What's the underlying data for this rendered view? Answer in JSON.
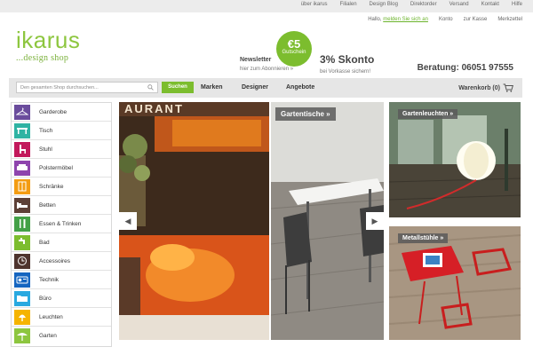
{
  "topbar": {
    "links": [
      "über ikarus",
      "Filialen",
      "Design Blog",
      "Direktorder",
      "Versand",
      "Kontakt",
      "Hilfe"
    ]
  },
  "userbar": {
    "greeting": "Hallo,",
    "login": "melden Sie sich an",
    "account": "Konto",
    "checkout": "zur Kasse",
    "wishlist": "Merkzettel"
  },
  "logo": {
    "main": "ikarus",
    "sub": "...design shop"
  },
  "newsletter": {
    "title": "Newsletter",
    "sub": "hier zum Abonnieren »",
    "badge_amount": "€5",
    "badge_label": "Gutschein"
  },
  "skonto": {
    "title": "3% Skonto",
    "sub": "bei Vorkasse sichern!"
  },
  "beratung": "Beratung: 06051 97555",
  "nav": {
    "search_placeholder": "Den gesamten Shop durchsuchen...",
    "search_button": "Suchen",
    "links": [
      "Marken",
      "Designer",
      "Angebote"
    ],
    "cart": "Warenkorb (0)"
  },
  "sidebar": {
    "items": [
      {
        "label": "Garderobe",
        "icon": "coat-hanger-icon",
        "color": "#6a4c9c"
      },
      {
        "label": "Tisch",
        "icon": "table-icon",
        "color": "#2fb3a3"
      },
      {
        "label": "Stuhl",
        "icon": "chair-icon",
        "color": "#c2185b"
      },
      {
        "label": "Polstermöbel",
        "icon": "sofa-icon",
        "color": "#8e44ad"
      },
      {
        "label": "Schränke",
        "icon": "cabinet-icon",
        "color": "#f39c12"
      },
      {
        "label": "Betten",
        "icon": "bed-icon",
        "color": "#5d4037"
      },
      {
        "label": "Essen & Trinken",
        "icon": "cutlery-icon",
        "color": "#43a047"
      },
      {
        "label": "Bad",
        "icon": "faucet-icon",
        "color": "#7cbd2e"
      },
      {
        "label": "Accessoires",
        "icon": "clock-icon",
        "color": "#4e342e"
      },
      {
        "label": "Technik",
        "icon": "radio-icon",
        "color": "#1565c0"
      },
      {
        "label": "Büro",
        "icon": "folder-icon",
        "color": "#29a9e0"
      },
      {
        "label": "Leuchten",
        "icon": "lamp-icon",
        "color": "#f5b400"
      },
      {
        "label": "Garten",
        "icon": "parasol-icon",
        "color": "#8dc63f"
      }
    ]
  },
  "hero": {
    "sign_text": "AURANT",
    "tag": "Gartentische »"
  },
  "tiles": {
    "top": "Gartenleuchten »",
    "bottom": "Metallstühle »"
  }
}
